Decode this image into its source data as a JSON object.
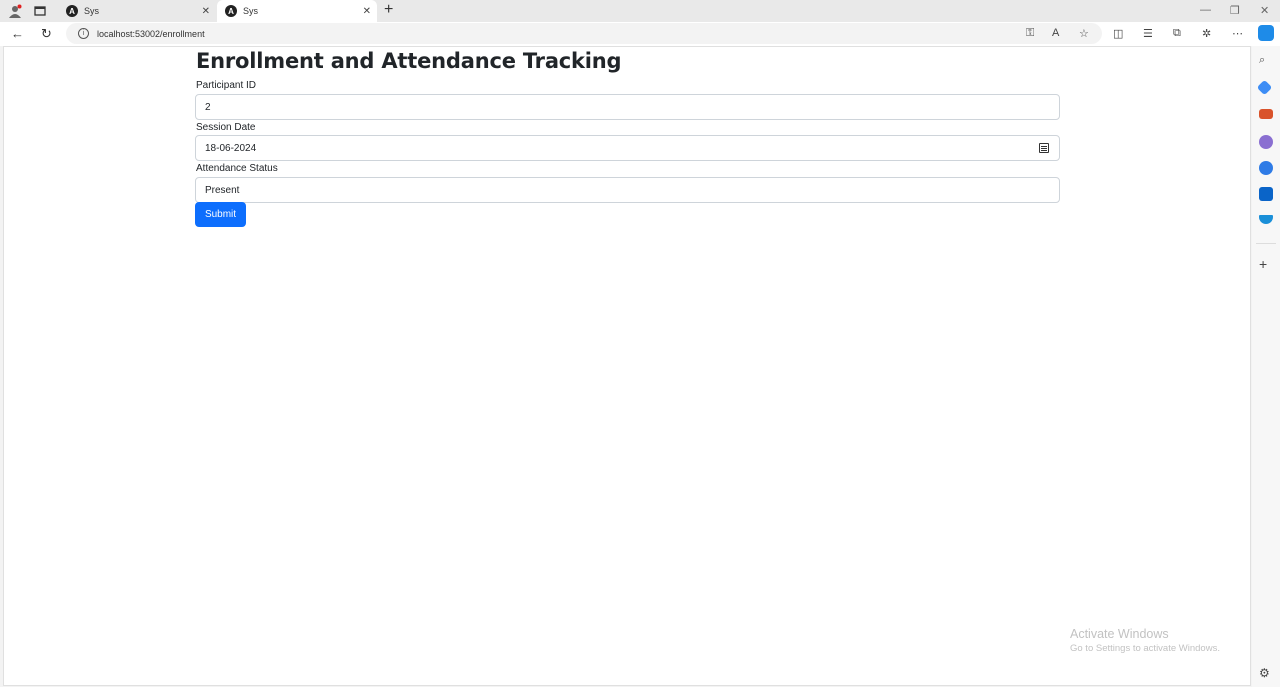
{
  "browser": {
    "tabs": [
      {
        "label": "Sys",
        "active": false
      },
      {
        "label": "Sys",
        "active": true
      }
    ],
    "new_tab": "+",
    "address": "localhost:53002/enrollment"
  },
  "page": {
    "title": "Enrollment and Attendance Tracking",
    "form": {
      "participant_label": "Participant ID",
      "participant_value": "2",
      "date_label": "Session Date",
      "date_value": "18-06-2024",
      "status_label": "Attendance Status",
      "status_value": "Present",
      "submit_label": "Submit"
    }
  },
  "watermark": {
    "line1": "Activate Windows",
    "line2": "Go to Settings to activate Windows."
  },
  "colors": {
    "accent": "#0d6efd"
  }
}
